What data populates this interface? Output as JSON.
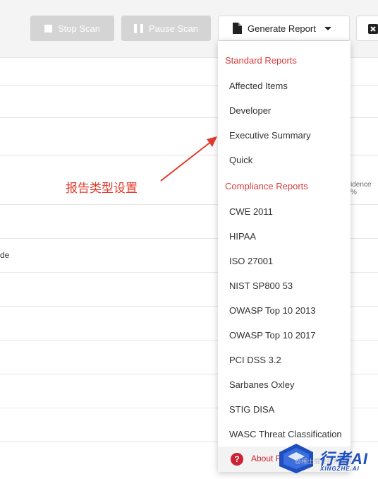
{
  "toolbar": {
    "stop_label": "Stop Scan",
    "pause_label": "Pause Scan",
    "generate_label": "Generate Report"
  },
  "background": {
    "partial_text_right": "idence %",
    "partial_text_left": "de"
  },
  "report_menu": {
    "standard_header": "Standard Reports",
    "standard_items": [
      "Affected Items",
      "Developer",
      "Executive Summary",
      "Quick"
    ],
    "compliance_header": "Compliance Reports",
    "compliance_items": [
      "CWE 2011",
      "HIPAA",
      "ISO 27001",
      "NIST SP800 53",
      "OWASP Top 10 2013",
      "OWASP Top 10 2017",
      "PCI DSS 3.2",
      "Sarbanes Oxley",
      "STIG DISA",
      "WASC Threat Classification"
    ],
    "about_label": "About Reports"
  },
  "annotation": {
    "text": "报告类型设置"
  },
  "watermark": {
    "main": "行者AI",
    "sub": "XINGZHE.AI",
    "small": "@稀土掘金技术社区"
  },
  "colors": {
    "accent_red": "#d93b3b",
    "annotation_red": "#e23b2c",
    "watermark_blue": "#1f4fbf"
  }
}
